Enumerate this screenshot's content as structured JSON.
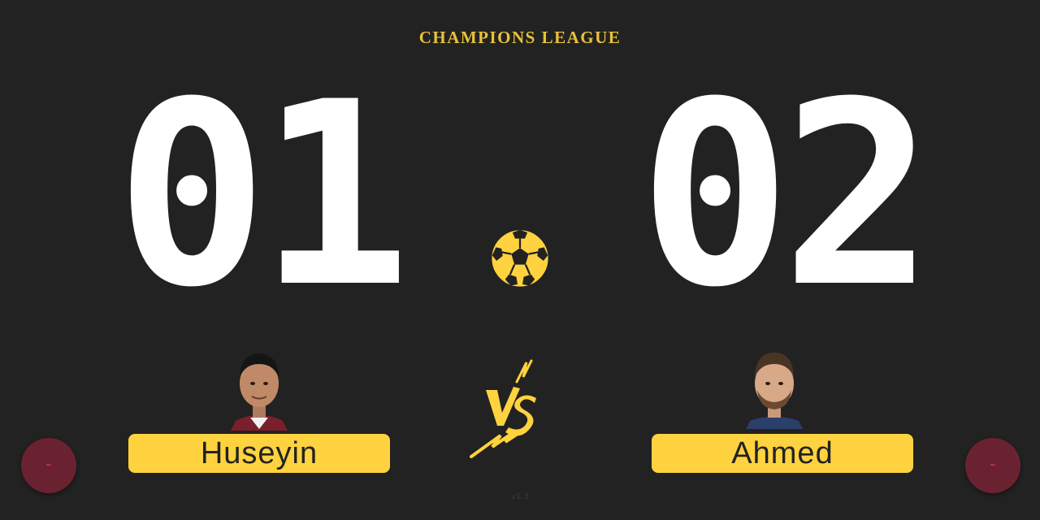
{
  "header": {
    "title": "CHAMPIONS LEAGUE"
  },
  "home": {
    "score": "01",
    "name": "Huseyin",
    "decrement_label": "-"
  },
  "away": {
    "score": "02",
    "name": "Ahmed",
    "decrement_label": "-"
  },
  "footer": {
    "version": "v1.3"
  },
  "icons": {
    "center": "soccer-ball-icon",
    "versus": "vs-emblem-icon"
  },
  "colors": {
    "background": "#222222",
    "accent": "#FFD23F",
    "title": "#E8C23A",
    "score": "#FFFFFF",
    "button": "#6B2230",
    "button_text": "#B03A4A"
  }
}
